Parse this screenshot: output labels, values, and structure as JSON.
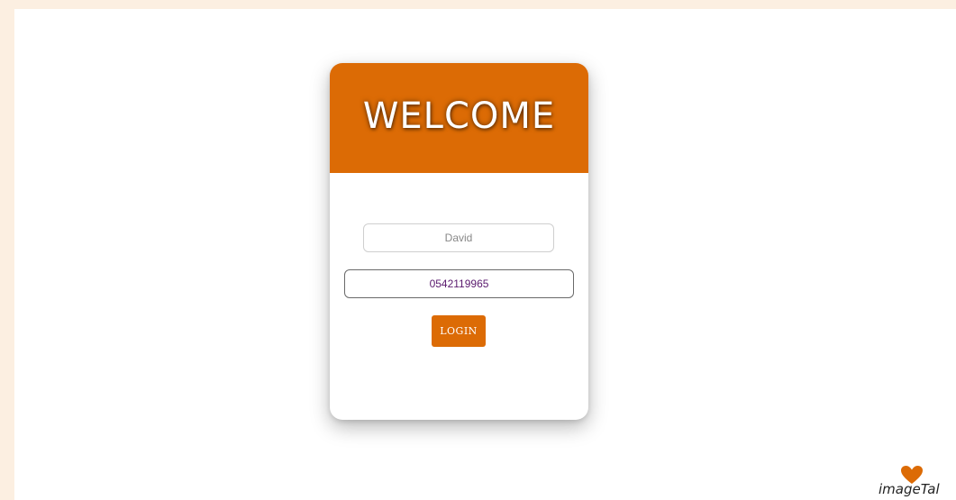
{
  "theme": {
    "accent": "#dc6b05",
    "page_background": "#ffffff",
    "outer_background": "#fcefe1"
  },
  "login_card": {
    "title": "WELCOME",
    "name_field": {
      "value": "",
      "placeholder": "David"
    },
    "phone_field": {
      "value": "0542119965"
    },
    "login_button": {
      "label": "LOGIN"
    }
  },
  "watermark": {
    "logo_text": "imageTal",
    "icon": "heart-icon"
  }
}
